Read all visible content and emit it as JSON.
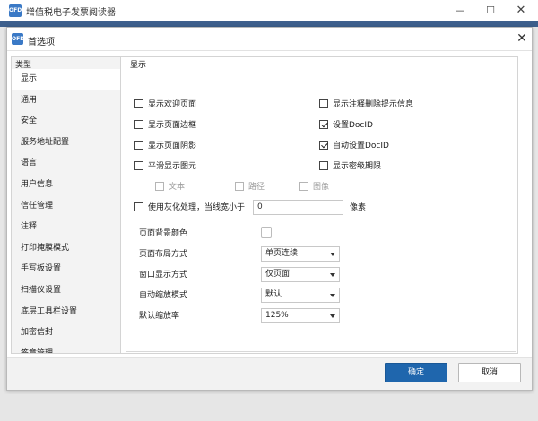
{
  "app": {
    "logo_text": "OFD",
    "title": "增值税电子发票阅读器",
    "minimize_glyph": "—",
    "maximize_glyph": "☐",
    "close_glyph": "✕"
  },
  "dialog": {
    "logo_text": "OFD",
    "title": "首选项",
    "close_glyph": "✕"
  },
  "sidebar": {
    "header": "类型",
    "selected_index": 0,
    "items": [
      {
        "label": "显示"
      },
      {
        "label": "通用"
      },
      {
        "label": "安全"
      },
      {
        "label": "服务地址配置"
      },
      {
        "label": "语言"
      },
      {
        "label": "用户信息"
      },
      {
        "label": "信任管理"
      },
      {
        "label": "注释"
      },
      {
        "label": "打印掩膜模式"
      },
      {
        "label": "手写板设置"
      },
      {
        "label": "扫描仪设置"
      },
      {
        "label": "底层工具栏设置"
      },
      {
        "label": "加密信封"
      },
      {
        "label": "签章管理"
      }
    ]
  },
  "display": {
    "group_title": "显示",
    "options_left": [
      {
        "label": "显示欢迎页面",
        "checked": false
      },
      {
        "label": "显示页面边框",
        "checked": false
      },
      {
        "label": "显示页面阴影",
        "checked": false
      },
      {
        "label": "平滑显示图元",
        "checked": false
      }
    ],
    "options_right": [
      {
        "label": "显示注释删除提示信息",
        "checked": false
      },
      {
        "label": "设置DocID",
        "checked": true
      },
      {
        "label": "自动设置DocID",
        "checked": true
      },
      {
        "label": "显示密级期限",
        "checked": false
      }
    ],
    "smooth_sub": [
      {
        "label": "文本",
        "checked": false
      },
      {
        "label": "路径",
        "checked": false
      },
      {
        "label": "图像",
        "checked": false
      }
    ],
    "gray": {
      "label": "使用灰化处理，当线宽小于",
      "value": "0",
      "unit": "像素",
      "checked": false
    },
    "bg_color_label": "页面背景颜色",
    "bg_color": "#ffffff",
    "layout_label": "页面布局方式",
    "layout_value": "单页连续",
    "window_label": "窗口显示方式",
    "window_value": "仅页面",
    "autozoom_label": "自动缩放模式",
    "autozoom_value": "默认",
    "default_zoom_label": "默认缩放率",
    "default_zoom_value": "125%"
  },
  "footer": {
    "ok_label": "确定",
    "cancel_label": "取消"
  },
  "colors": {
    "accent": "#1f66ad",
    "app_logo": "#3a79c6"
  }
}
